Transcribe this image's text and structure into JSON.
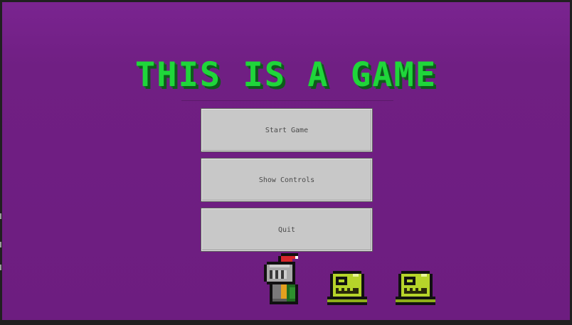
{
  "game": {
    "title": "THIS IS A GAME",
    "title_color": "#1fd63a",
    "background_color": "#6d1d80"
  },
  "menu": {
    "buttons": [
      {
        "label": "Start Game"
      },
      {
        "label": "Show Controls"
      },
      {
        "label": "Quit"
      }
    ]
  },
  "sprites": [
    {
      "name": "knight"
    },
    {
      "name": "slime-monster"
    },
    {
      "name": "slime-monster"
    }
  ]
}
